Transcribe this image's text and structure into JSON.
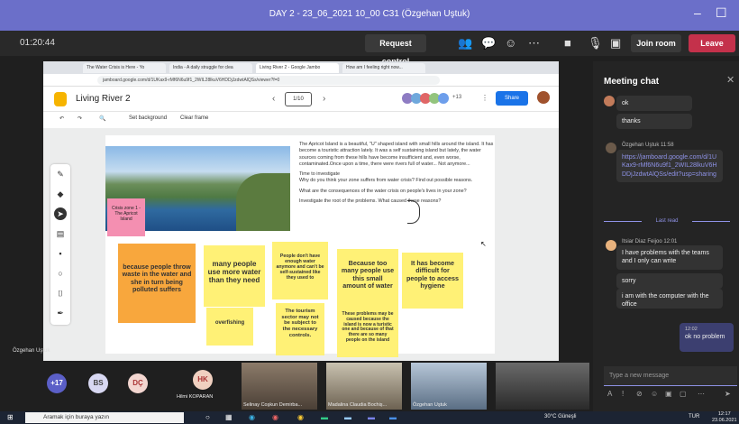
{
  "titlebar": {
    "title": "DAY 2 - 23_06_2021 10_00 C31 (Özgehan Uştuk)"
  },
  "toolbar": {
    "timer": "01:20:44",
    "request_control": "Request control",
    "join_room": "Join room",
    "leave": "Leave"
  },
  "browser": {
    "tabs": [
      "The Water Crisis is Here - Yo",
      "India - A daily struggle for clea",
      "Living River 2 - Google Jambo",
      "How am I feeling right now..."
    ],
    "url": "jamboard.google.com/d/1UKax9-rMf6N6u9f1_2WIL28lkuV6HDDjJzdwtAlQSs/viewer?f=0"
  },
  "jamboard": {
    "title": "Living River 2",
    "frame_indicator": "1/10",
    "avatar_more": "+13",
    "share": "Share",
    "set_background": "Set background",
    "clear_frame": "Clear frame",
    "pink_note": "Crisis zone 1 - The Apricot Island",
    "text_p1": "The Apricot Island is a beautiful, \"U\" shaped island with small hills around the island. It has become a touristic attraction lately. It was a self sustaining island but lately, the water sources coming from these hills have become insufficient and, even worse, contaminated.Once upon a time, there were rivers full of water... Not anymore...",
    "text_p2": "Time to investigate\nWhy do you think your zone suffers from water crisis? Find out possible reasons.",
    "text_p3": "What are the consequences of the water crisis on people's lives in your zone?",
    "text_p4": "Investigate the root of the problems. What caused these reasons?",
    "stickies": [
      "because people throw waste in the water and she in turn being polluted suffers",
      "many people use more water than they need",
      "overfishing",
      "People don't have enough water anymore and can't be self-sustained like they used to",
      "The tourism sector may not be subject to the necessary controls.",
      "Because too many people use this small amount of water",
      "These problems may be caused because the island is now a turistic one and because of that there are so many people on the island",
      "It has become difficult for people to access hygiene"
    ]
  },
  "presenter_label": "Özgehan Uştuk",
  "chat": {
    "header": "Meeting chat",
    "msg_ok": "ok",
    "msg_thanks": "thanks",
    "sender1": "Özgehan Uştuk  11:58",
    "msg_link": "https://jamboard.google.com/d/1UKax9-rMf6N6u9f1_2WIL28lkuV6HDDjJzdwtAlQSs/edit?usp=sharing",
    "last_read": "Last read",
    "sender2": "Itsiar Diaz Feijoo  12:01",
    "msg_problems": "I have problems with the teams and I only can write",
    "msg_sorry": "sorry",
    "msg_computer": "i am with the computer with the office",
    "own_time": "12:02",
    "own_msg": "ok no problem",
    "type_placeholder": "Type a new message"
  },
  "participants": {
    "more": "+17",
    "bs": "BS",
    "dc": "DÇ",
    "hk": "HK",
    "hk_name": "Hilmi KOPARAN",
    "names": [
      "Selinay Coşkun Demirba...",
      "Madalina Claudia Bochiș...",
      "Özgehan Uştuk",
      ""
    ]
  },
  "taskbar": {
    "search": "Aramak için buraya yazın",
    "weather": "30°C Güneşli",
    "lang": "TUR",
    "time": "12:17",
    "date": "23.06.2021"
  },
  "colors": {
    "teams_purple": "#6b6fc9",
    "leave_red": "#c4314b",
    "sticky_yellow": "#fff176",
    "sticky_orange": "#f8a73d",
    "sticky_pink": "#f48fb1"
  }
}
